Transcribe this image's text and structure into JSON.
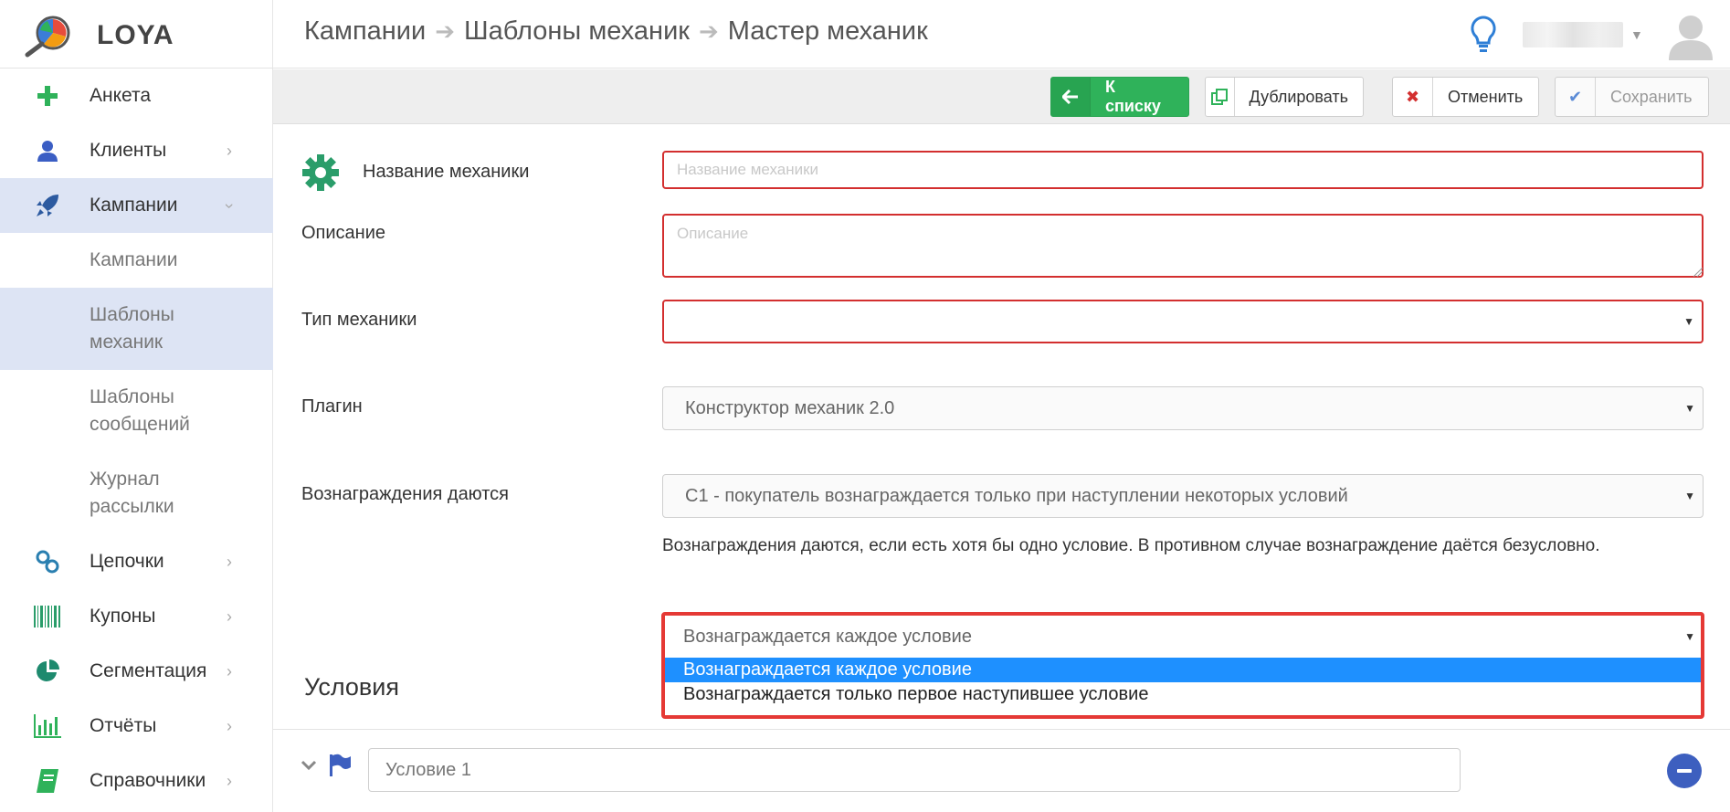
{
  "brand": {
    "name": "LOYA"
  },
  "sidebar": {
    "items": [
      {
        "label": "Анкета",
        "icon": "plus-icon",
        "chevron": false
      },
      {
        "label": "Клиенты",
        "icon": "user-icon",
        "chevron": true
      },
      {
        "label": "Кампании",
        "icon": "rocket-icon",
        "chevron": true,
        "active": true,
        "expanded": true
      }
    ],
    "subitems": [
      {
        "label": "Кампании"
      },
      {
        "label": "Шаблоны механик",
        "active": true
      },
      {
        "label": "Шаблоны сообщений"
      },
      {
        "label": "Журнал рассылки"
      }
    ],
    "bottom_items": [
      {
        "label": "Цепочки",
        "icon": "chain-icon"
      },
      {
        "label": "Купоны",
        "icon": "barcode-icon"
      },
      {
        "label": "Сегментация",
        "icon": "pie-chart-icon"
      },
      {
        "label": "Отчёты",
        "icon": "bar-chart-icon"
      },
      {
        "label": "Справочники",
        "icon": "book-icon"
      }
    ]
  },
  "header": {
    "breadcrumb": [
      "Кампании",
      "Шаблоны механик",
      "Мастер механик"
    ]
  },
  "toolbar": {
    "to_list": "К списку",
    "duplicate": "Дублировать",
    "cancel": "Отменить",
    "save": "Сохранить"
  },
  "form": {
    "name_label": "Название механики",
    "name_placeholder": "Название механики",
    "description_label": "Описание",
    "description_placeholder": "Описание",
    "type_label": "Тип механики",
    "type_value": "",
    "plugin_label": "Плагин",
    "plugin_value": "Конструктор механик 2.0",
    "rewards_label": "Вознаграждения даются",
    "rewards_value": "С1 - покупатель вознаграждается только при наступлении некоторых условий",
    "rewards_help": "Вознаграждения даются, если есть хотя бы одно условие. В противном случае вознаграждение даётся безусловно.",
    "reward_mode": {
      "current": "Вознаграждается каждое условие",
      "options": [
        "Вознаграждается каждое условие",
        "Вознаграждается только первое наступившее условие"
      ],
      "selected_index": 0
    }
  },
  "conditions": {
    "title": "Условия",
    "items": [
      {
        "value": "Условие 1"
      }
    ]
  },
  "colors": {
    "accent_green": "#2fb25a",
    "error_red": "#d32f2f",
    "active_nav": "#dde4f4",
    "selection_blue": "#1e90ff"
  }
}
